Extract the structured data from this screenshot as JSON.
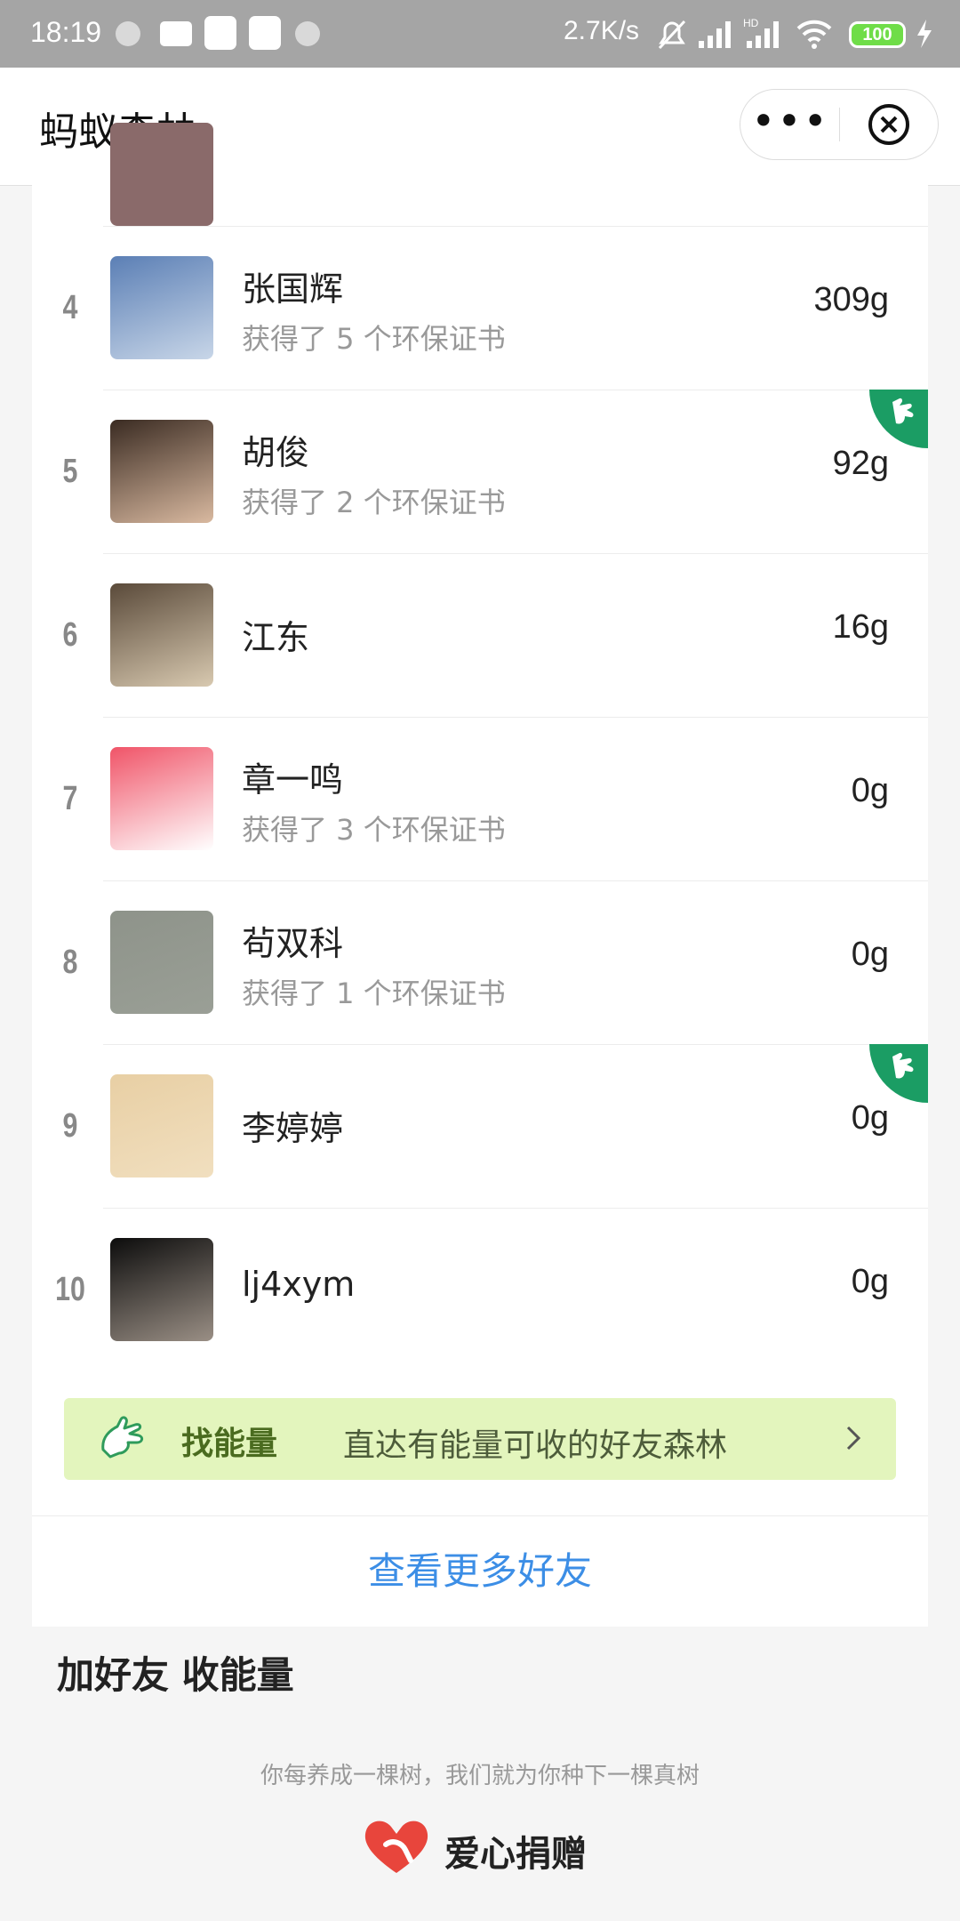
{
  "status_bar": {
    "time": "18:19",
    "speed": "2.7K/s",
    "battery": "100",
    "signal": "HD"
  },
  "nav": {
    "title": "蚂蚁森林",
    "more_icon": "more-dots-icon",
    "close_icon": "close-circle-icon"
  },
  "rows": [
    {
      "rank": "4",
      "name": "张国辉",
      "certs": "获得了 5 个环保证书",
      "energy": "309g",
      "badge": false,
      "avatar_colors": [
        "#5b7fb5",
        "#c8d6e8"
      ]
    },
    {
      "rank": "5",
      "name": "胡俊",
      "certs": "获得了 2 个环保证书",
      "energy": "92g",
      "badge": true,
      "avatar_colors": [
        "#3a2b22",
        "#d9b9a0"
      ]
    },
    {
      "rank": "6",
      "name": "江东",
      "certs": "",
      "energy": "16g",
      "badge": false,
      "avatar_colors": [
        "#5a4a3a",
        "#d8c9b0"
      ]
    },
    {
      "rank": "7",
      "name": "章一鸣",
      "certs": "获得了 3 个环保证书",
      "energy": "0g",
      "badge": false,
      "avatar_colors": [
        "#f05468",
        "#ffffff"
      ]
    },
    {
      "rank": "8",
      "name": "茍双科",
      "certs": "获得了 1 个环保证书",
      "energy": "0g",
      "badge": false,
      "avatar_colors": [
        "#8e938a",
        "#9a9f96"
      ]
    },
    {
      "rank": "9",
      "name": "李婷婷",
      "certs": "",
      "energy": "0g",
      "badge": true,
      "avatar_colors": [
        "#e8cfa4",
        "#f1dfbf"
      ]
    },
    {
      "rank": "10",
      "name": "lj4xym",
      "certs": "",
      "energy": "0g",
      "badge": false,
      "avatar_colors": [
        "#0c0c0c",
        "#9a8f85"
      ]
    }
  ],
  "find_energy": {
    "bold": "找能量",
    "text": "直达有能量可收的好友森林",
    "icon": "hand-icon"
  },
  "more_friends": "查看更多好友",
  "add_friends_title": "加好友 收能量",
  "bottom_note": "你每养成一棵树，我们就为你种下一棵真树",
  "donate_label": "爱心捐赠",
  "colors": {
    "accent_green": "#1b9d64",
    "link_blue": "#3c8ee6",
    "banner_bg": "#e3f5bd",
    "donate_red": "#e8453c"
  }
}
